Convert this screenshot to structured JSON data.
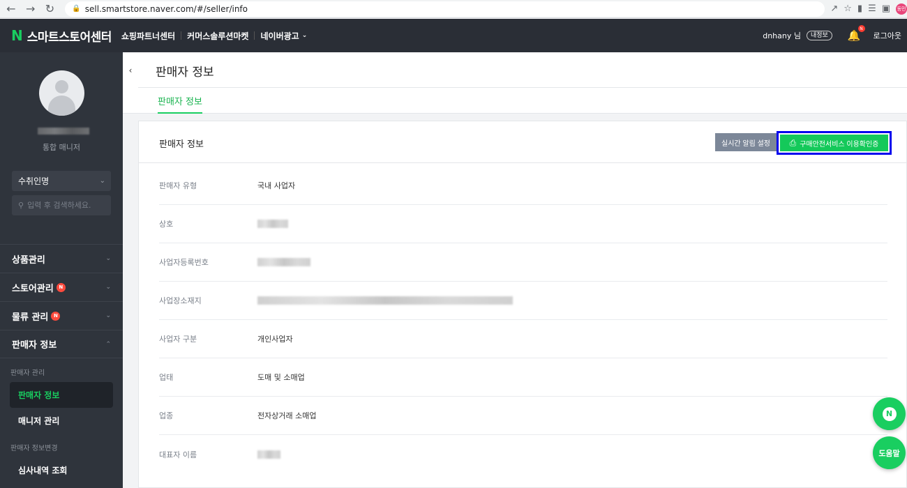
{
  "browser": {
    "url": "sell.smartstore.naver.com/#/seller/info",
    "profile": "동민"
  },
  "header": {
    "logo_letter": "N",
    "logo_text": "스마트스토어센터",
    "nav": [
      "쇼핑파트너센터",
      "커머스솔루션마켓",
      "네이버광고"
    ],
    "user": "dnhany 님",
    "my_info": "내정보",
    "bell_badge": "N",
    "logout": "로그아웃"
  },
  "sidebar": {
    "role": "통합 매니저",
    "store_select": "수취인명",
    "search_placeholder": "입력 후 검색하세요.",
    "menu": [
      {
        "label": "상품관리",
        "badge": ""
      },
      {
        "label": "스토어관리",
        "badge": "N"
      },
      {
        "label": "물류 관리",
        "badge": "N"
      },
      {
        "label": "판매자 정보",
        "badge": ""
      }
    ],
    "sub_head_1": "판매자 관리",
    "sub_items_1": [
      "판매자 정보",
      "매니저 관리"
    ],
    "sub_head_2": "판매자 정보변경",
    "sub_items_2": [
      "심사내역 조회"
    ]
  },
  "content": {
    "page_title": "판매자 정보",
    "tab": "판매자 정보",
    "panel_title": "판매자 정보",
    "btn_alert": "실시간 알림 설정",
    "btn_cert": "구매안전서비스 이용확인증",
    "rows": [
      {
        "label": "판매자 유형",
        "value": "국내 사업자"
      },
      {
        "label": "상호",
        "value": ""
      },
      {
        "label": "사업자등록번호",
        "value": ""
      },
      {
        "label": "사업장소재지",
        "value": ""
      },
      {
        "label": "사업자 구분",
        "value": "개인사업자"
      },
      {
        "label": "업태",
        "value": "도매 및 소매업"
      },
      {
        "label": "업종",
        "value": "전자상거래 소매업"
      },
      {
        "label": "대표자 이름",
        "value": ""
      }
    ]
  },
  "floating": {
    "help": "도움말"
  },
  "colors": {
    "brand_green": "#19ce60",
    "sidebar_bg": "#2f343c",
    "header_bg": "#2a2e36",
    "highlight_frame": "#0000ee"
  }
}
